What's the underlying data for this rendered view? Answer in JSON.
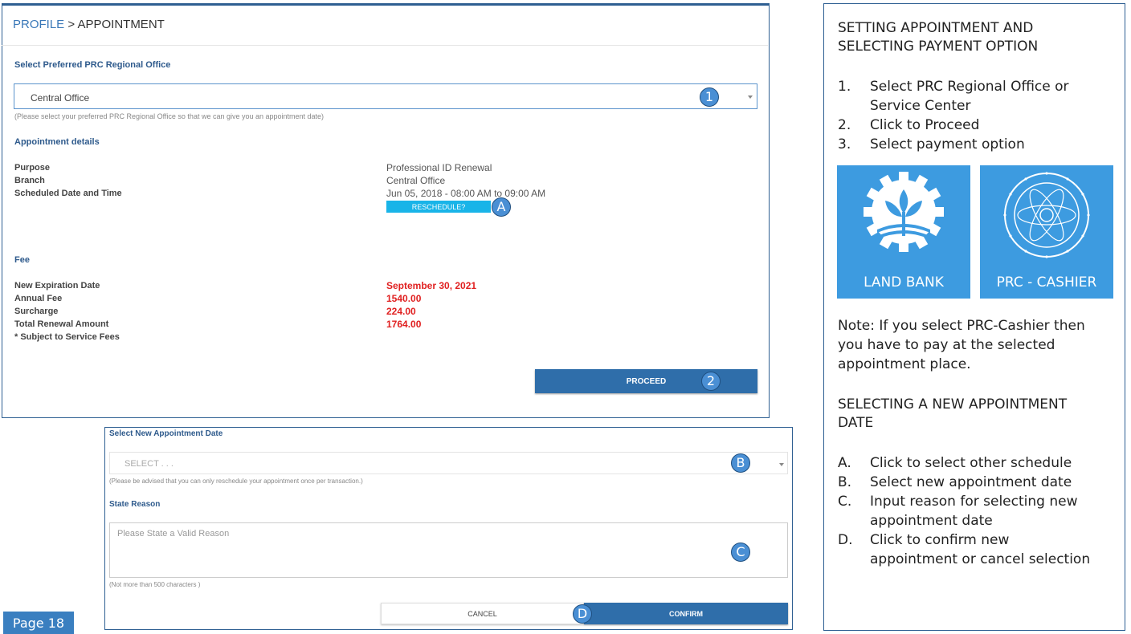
{
  "breadcrumb": {
    "profile": "PROFILE",
    "separator": " > ",
    "current": "APPOINTMENT"
  },
  "office_section": {
    "title": "Select Preferred PRC Regional Office",
    "selected": "Central Office",
    "hint": "(Please select your preferred PRC Regional Office so that we can give you an appointment date)",
    "badge": "1"
  },
  "appointment": {
    "title": "Appointment details",
    "rows": [
      {
        "label": "Purpose",
        "value": "Professional ID Renewal"
      },
      {
        "label": "Branch",
        "value": "Central Office"
      },
      {
        "label": "Scheduled Date and Time",
        "value": "Jun 05, 2018 - 08:00 AM to 09:00 AM"
      }
    ],
    "reschedule_label": "RESCHEDULE?",
    "badge": "A"
  },
  "fee": {
    "title": "Fee",
    "rows": [
      {
        "label": "New Expiration Date",
        "value": "September 30, 2021"
      },
      {
        "label": "Annual Fee",
        "value": "1540.00"
      },
      {
        "label": "Surcharge",
        "value": "224.00"
      },
      {
        "label": "Total Renewal Amount",
        "value": "1764.00"
      }
    ],
    "note": "* Subject to Service Fees"
  },
  "proceed": {
    "label": "PROCEED",
    "badge": "2"
  },
  "reschedule": {
    "date_title": "Select New Appointment Date",
    "date_placeholder": "SELECT . . .",
    "date_hint": "(Please be advised that you can only reschedule your appointment once per transaction.)",
    "date_badge": "B",
    "reason_title": "State Reason",
    "reason_placeholder": "Please State a Valid Reason",
    "reason_hint": "(Not more than 500 characters )",
    "reason_badge": "C",
    "cancel_label": "CANCEL",
    "confirm_label": "CONFIRM",
    "confirm_badge": "D"
  },
  "instructions": {
    "title1_line1": "SETTING APPOINTMENT AND",
    "title1_line2": "SELECTING PAYMENT OPTION",
    "steps": [
      {
        "num": "1.",
        "line1": "Select PRC Regional Office or",
        "line2": "Service Center"
      },
      {
        "num": "2.",
        "line1": "Click to Proceed"
      },
      {
        "num": "3.",
        "line1": "Select payment option"
      }
    ],
    "tiles": [
      {
        "caption": "LAND BANK"
      },
      {
        "caption": "PRC - CASHIER"
      }
    ],
    "note_line1": "Note: If you select PRC-Cashier then",
    "note_line2": "you have to pay at the selected",
    "note_line3": "appointment place.",
    "title2_line1": "SELECTING A NEW APPOINTMENT",
    "title2_line2": "DATE",
    "steps2": [
      {
        "num": "A.",
        "line1": "Click to select other schedule"
      },
      {
        "num": "B.",
        "line1": "Select new appointment date"
      },
      {
        "num": "C.",
        "line1": "Input reason for selecting new",
        "line2": "appointment date"
      },
      {
        "num": "D.",
        "line1": "Click to confirm new",
        "line2": "appointment or cancel selection"
      }
    ]
  },
  "page_label": "Page 18",
  "colors": {
    "accent": "#2f6eaa",
    "cyan": "#19b4e8",
    "fee_red": "#e02020",
    "tile": "#3d9be0"
  },
  "icons": [
    "land-bank-logo-icon",
    "prc-seal-icon",
    "chevron-down-icon"
  ]
}
